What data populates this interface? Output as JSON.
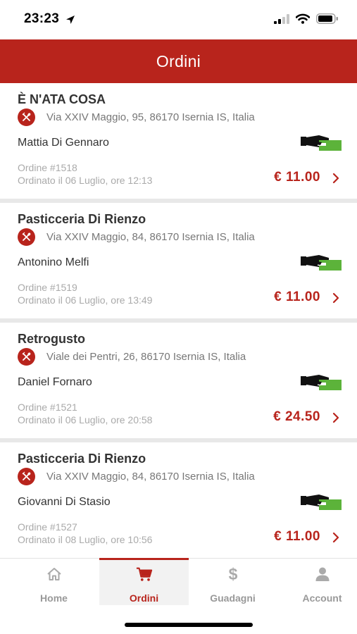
{
  "status_bar": {
    "time": "23:23"
  },
  "header": {
    "title": "Ordini"
  },
  "orders": [
    {
      "restaurant": "È N'ATA COSA",
      "address": "Via XXIV Maggio, 95, 86170 Isernia IS, Italia",
      "customer": "Mattia Di Gennaro",
      "order_number": "Ordine #1518",
      "ordered_at": "Ordinato il 06 Luglio, ore 12:13",
      "price": "€ 11.00"
    },
    {
      "restaurant": "Pasticceria Di Rienzo",
      "address": "Via XXIV Maggio, 84, 86170 Isernia IS, Italia",
      "customer": "Antonino Melfi",
      "order_number": "Ordine #1519",
      "ordered_at": "Ordinato il 06 Luglio, ore 13:49",
      "price": "€ 11.00"
    },
    {
      "restaurant": "Retrogusto",
      "address": "Viale dei Pentri, 26, 86170 Isernia IS, Italia",
      "customer": "Daniel Fornaro",
      "order_number": "Ordine #1521",
      "ordered_at": "Ordinato il 06 Luglio, ore 20:58",
      "price": "€ 24.50"
    },
    {
      "restaurant": "Pasticceria Di Rienzo",
      "address": "Via XXIV Maggio, 84, 86170 Isernia IS, Italia",
      "customer": "Giovanni Di Stasio",
      "order_number": "Ordine #1527",
      "ordered_at": "Ordinato il 08 Luglio, ore 10:56",
      "price": "€ 11.00"
    }
  ],
  "tabs": [
    {
      "label": "Home",
      "icon": "home-icon",
      "active": false
    },
    {
      "label": "Ordini",
      "icon": "cart-icon",
      "active": true
    },
    {
      "label": "Guadagni",
      "icon": "dollar-icon",
      "active": false
    },
    {
      "label": "Account",
      "icon": "user-icon",
      "active": false
    }
  ],
  "colors": {
    "brand": "#b8241c",
    "cash_green": "#5cb33a",
    "muted_text": "#aaaaaa"
  },
  "order_icons": {
    "restaurant": "fork-knife-icon",
    "payment": "cash-payment-icon",
    "open": "chevron-right-icon"
  }
}
